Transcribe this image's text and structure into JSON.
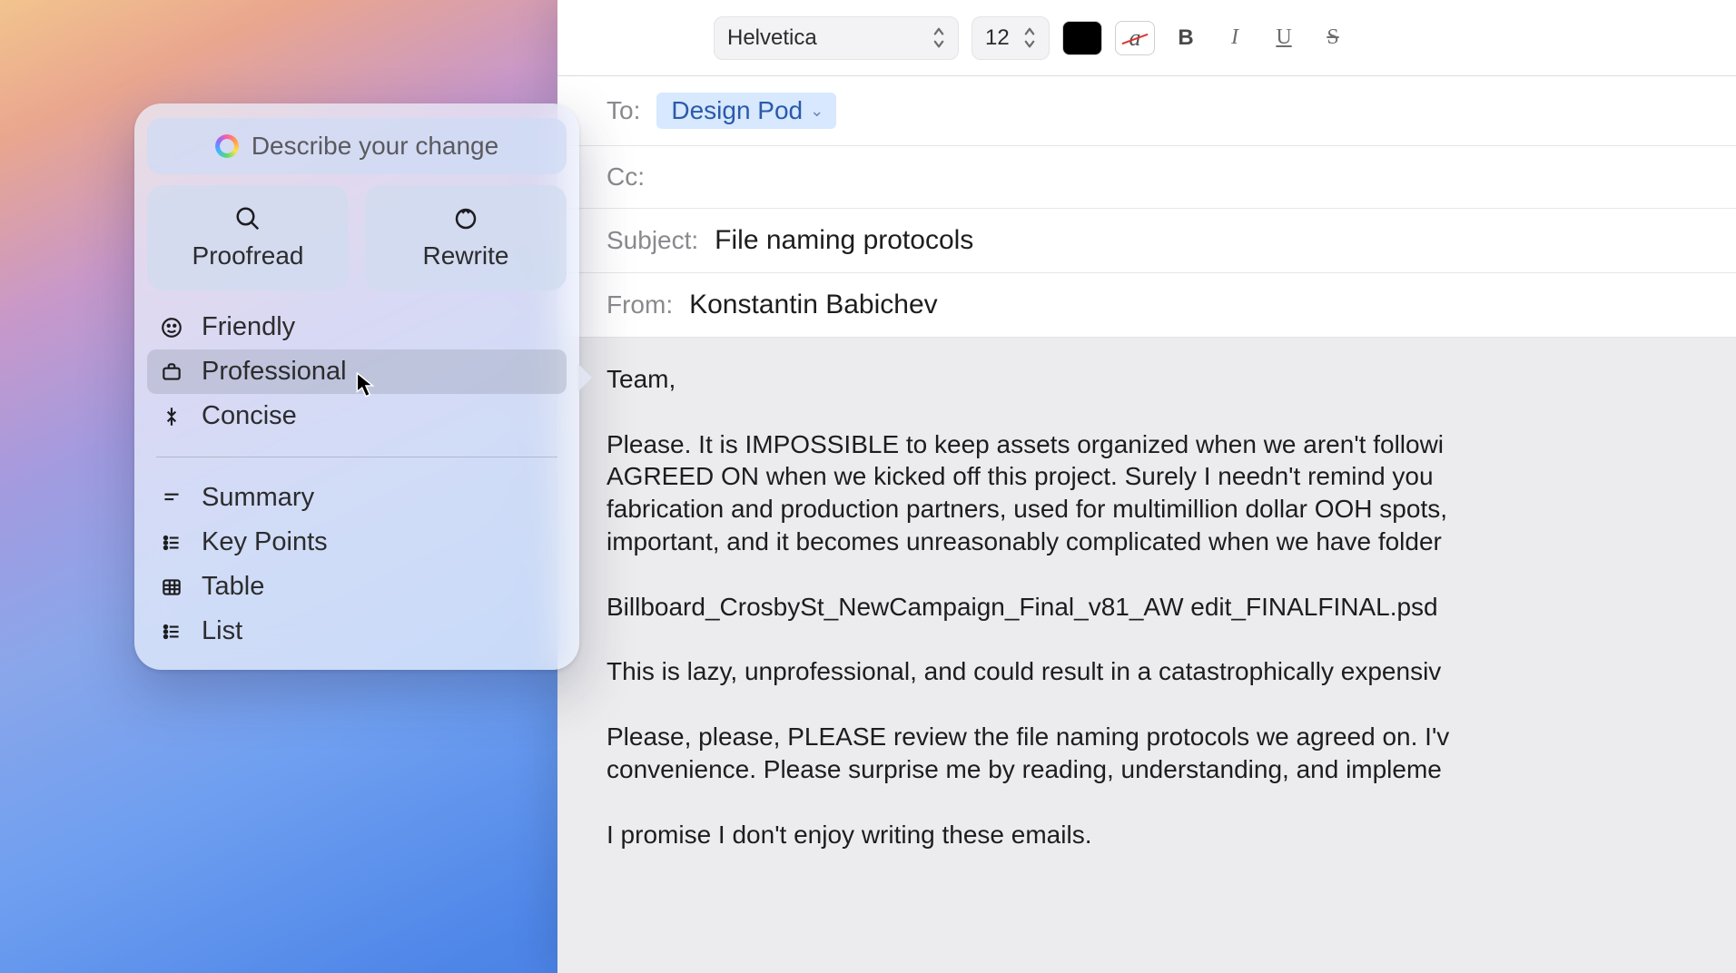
{
  "toolbar": {
    "font": "Helvetica",
    "size": "12",
    "bold": "B",
    "italic": "I",
    "underline": "U",
    "strike": "S",
    "no_highlight_glyph": "a"
  },
  "headers": {
    "to_label": "To:",
    "to_chip": "Design Pod",
    "cc_label": "Cc:",
    "subject_label": "Subject:",
    "subject_value": "File naming protocols",
    "from_label": "From:",
    "from_value": "Konstantin Babichev"
  },
  "body": "Team,\n\nPlease. It is IMPOSSIBLE to keep assets organized when we aren't followi\nAGREED ON when we kicked off this project. Surely I needn't remind you \nfabrication and production partners, used for multimillion dollar OOH spots,\nimportant, and it becomes unreasonably complicated when we have folder\n\nBillboard_CrosbySt_NewCampaign_Final_v81_AW edit_FINALFINAL.psd\n\nThis is lazy, unprofessional, and could result in a catastrophically expensiv\n\nPlease, please, PLEASE review the file naming protocols we agreed on. I'v\nconvenience. Please surprise me by reading, understanding, and impleme\n\nI promise I don't enjoy writing these emails.",
  "popover": {
    "describe": "Describe your change",
    "proofread": "Proofread",
    "rewrite": "Rewrite",
    "tones": {
      "friendly": "Friendly",
      "professional": "Professional",
      "concise": "Concise"
    },
    "transforms": {
      "summary": "Summary",
      "key_points": "Key Points",
      "table": "Table",
      "list": "List"
    },
    "selected": "professional"
  }
}
